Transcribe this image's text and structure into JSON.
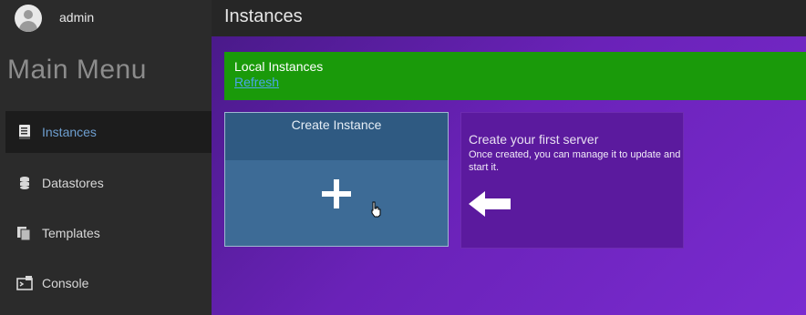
{
  "user": {
    "name": "admin",
    "avatar_icon": "user-avatar-icon"
  },
  "sidebar": {
    "title": "Main Menu",
    "items": [
      {
        "label": "Instances",
        "icon": "document-icon",
        "active": true
      },
      {
        "label": "Datastores",
        "icon": "database-icon",
        "active": false
      },
      {
        "label": "Templates",
        "icon": "templates-icon",
        "active": false
      },
      {
        "label": "Console",
        "icon": "console-icon",
        "active": false
      }
    ]
  },
  "header": {
    "title": "Instances"
  },
  "banner": {
    "title": "Local Instances",
    "refresh_label": "Refresh",
    "color": "#1a9a0a"
  },
  "create_card": {
    "title": "Create Instance",
    "icon": "plus-icon"
  },
  "info_card": {
    "title": "Create your first server",
    "description": "Once created, you can manage it to update and start it.",
    "icon": "arrow-left-icon"
  },
  "colors": {
    "accent": "#6e9fd0",
    "content_bg": "#6a22b8",
    "card_blue": "#3d6b96"
  }
}
